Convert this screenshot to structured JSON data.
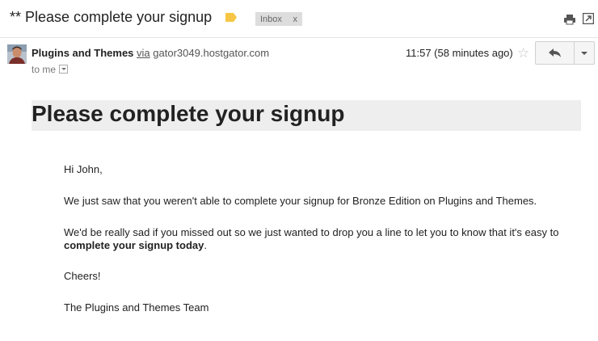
{
  "header": {
    "subject": "** Please complete your signup",
    "label_color": "#f6c644",
    "inbox_chip": {
      "label": "Inbox",
      "remove": "x"
    },
    "icons": [
      "print-icon",
      "new-window-icon"
    ]
  },
  "message": {
    "sender_name": "Plugins and Themes",
    "via": "via",
    "sender_host": "gator3049.hostgator.com",
    "recipients": "to me",
    "timestamp": "11:57 (58 minutes ago)",
    "actions": [
      "star-icon",
      "reply-icon",
      "more-options-icon"
    ]
  },
  "email": {
    "heading": "Please complete your signup",
    "greeting": "Hi John,",
    "paragraph1": "We just saw that you weren't able to complete your signup for Bronze Edition on Plugins and Themes.",
    "paragraph2_start": "We'd be really sad if you missed out so we just wanted to drop you a line to let you to know that it's easy to ",
    "paragraph2_bold": "complete your signup today",
    "paragraph2_end": ".",
    "closing": "Cheers!",
    "signature": "The Plugins and Themes Team"
  }
}
